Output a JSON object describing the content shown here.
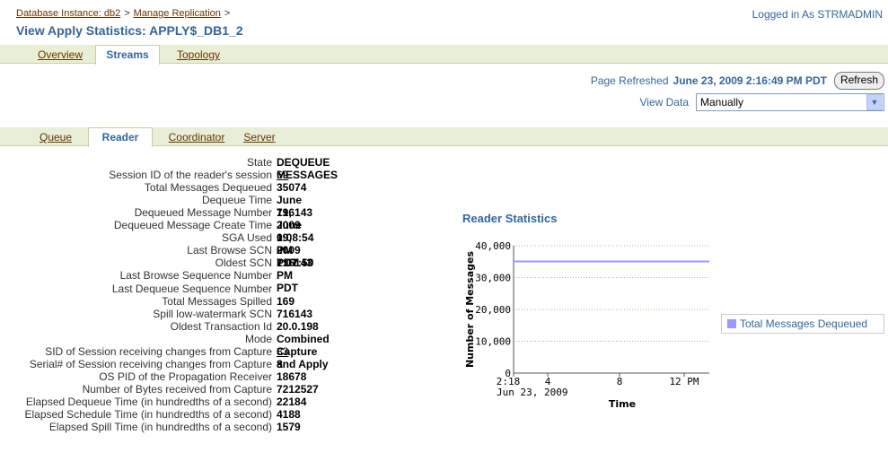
{
  "breadcrumb": {
    "items": [
      "Database Instance: db2",
      "Manage Replication"
    ],
    "separator": ">"
  },
  "login_text": "Logged in As STRMADMIN",
  "page_title": "View Apply Statistics: APPLY$_DB1_2",
  "top_tabs": [
    {
      "label": "Overview",
      "active": false
    },
    {
      "label": "Streams",
      "active": true
    },
    {
      "label": "Topology",
      "active": false
    }
  ],
  "refresh": {
    "label": "Page Refreshed",
    "time": "June 23, 2009 2:16:49 PM PDT",
    "button": "Refresh"
  },
  "view_data": {
    "label": "View Data",
    "selected": "Manually"
  },
  "sub_tabs": [
    {
      "label": "Queue",
      "active": false
    },
    {
      "label": "Reader",
      "active": true
    },
    {
      "label": "Coordinator",
      "active": false
    },
    {
      "label": "Server",
      "active": false
    }
  ],
  "details": [
    {
      "label": "State",
      "value": "DEQUEUE MESSAGES",
      "link": false
    },
    {
      "label": "Session ID of the reader's session",
      "value": "69",
      "link": true
    },
    {
      "label": "Total Messages Dequeued",
      "value": "35074",
      "link": false
    },
    {
      "label": "Dequeue Time",
      "value": "June 19, 2009 1:08:54 PM PDT",
      "link": false
    },
    {
      "label": "Dequeued Message Number",
      "value": "716143",
      "link": false
    },
    {
      "label": "Dequeued Message Create Time",
      "value": "June 19, 2009 1:07:50 PM PDT",
      "link": false
    },
    {
      "label": "SGA Used",
      "value": "0",
      "link": false
    },
    {
      "label": "Last Browse SCN",
      "value": "0",
      "link": false
    },
    {
      "label": "Oldest SCN",
      "value": "716143",
      "link": false
    },
    {
      "label": "Last Browse Sequence Number",
      "value": "",
      "link": false
    },
    {
      "label": "Last Dequeue Sequence Number",
      "value": "",
      "link": false
    },
    {
      "label": "Total Messages Spilled",
      "value": "169",
      "link": false
    },
    {
      "label": "Spill low-watermark SCN",
      "value": "716143",
      "link": false
    },
    {
      "label": "Oldest Transaction Id",
      "value": "20.0.198",
      "link": false
    },
    {
      "label": "Mode",
      "value": "Combined Capture and Apply",
      "link": false
    },
    {
      "label": "SID of Session receiving changes from Capture",
      "value": "83",
      "link": true
    },
    {
      "label": "Serial# of Session receiving changes from Capture",
      "value": "8",
      "link": false
    },
    {
      "label": "OS PID of the Propagation Receiver",
      "value": "18678",
      "link": false
    },
    {
      "label": "Number of Bytes received from Capture",
      "value": "7212527",
      "link": false
    },
    {
      "label": "Elapsed Dequeue Time (in hundredths of a second)",
      "value": "22184",
      "link": false
    },
    {
      "label": "Elapsed Schedule Time (in hundredths of a second)",
      "value": "4188",
      "link": false
    },
    {
      "label": "Elapsed Spill Time (in hundredths of a second)",
      "value": "1579",
      "link": false
    }
  ],
  "chart_title": "Reader Statistics",
  "chart_data": {
    "type": "line",
    "xlabel": "Time",
    "ylabel": "Number of Messages",
    "ylim": [
      0,
      40000
    ],
    "yticks": [
      "0",
      "10,000",
      "20,000",
      "30,000",
      "40,000"
    ],
    "xticks": [
      "2:18",
      "4",
      "8",
      "12 PM"
    ],
    "xtick_sublabel": "Jun 23, 2009",
    "series": [
      {
        "name": "Total Messages Dequeued",
        "values": [
          35074,
          35074
        ],
        "color": "#9999ff"
      }
    ],
    "legend": "right",
    "grid": true
  },
  "colors": {
    "title": "#336699",
    "link": "#663300",
    "tabbar": "#e9eed6",
    "series": "#9999ff"
  }
}
